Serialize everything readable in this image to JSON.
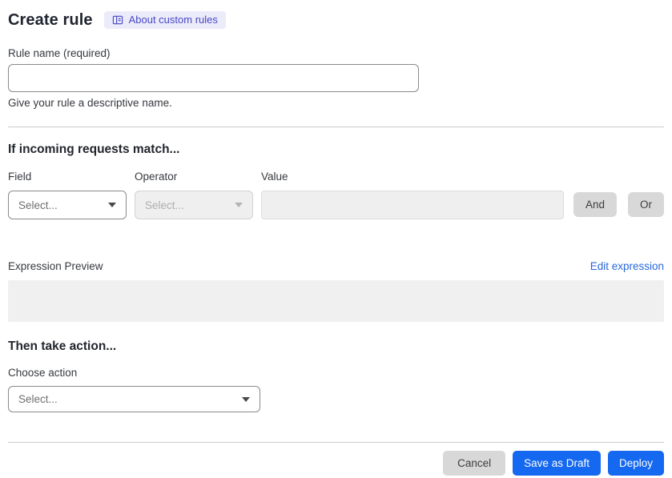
{
  "header": {
    "title": "Create rule",
    "about_badge": "About custom rules"
  },
  "rule_name": {
    "label": "Rule name (required)",
    "value": "",
    "helper": "Give your rule a descriptive name."
  },
  "match_section": {
    "heading": "If incoming requests match...",
    "field": {
      "label": "Field",
      "placeholder": "Select..."
    },
    "operator": {
      "label": "Operator",
      "placeholder": "Select..."
    },
    "value": {
      "label": "Value",
      "value": ""
    },
    "and_label": "And",
    "or_label": "Or"
  },
  "expression": {
    "label": "Expression Preview",
    "edit_link": "Edit expression",
    "content": ""
  },
  "action_section": {
    "heading": "Then take action...",
    "choose_label": "Choose action",
    "placeholder": "Select..."
  },
  "footer": {
    "cancel": "Cancel",
    "save_draft": "Save as Draft",
    "deploy": "Deploy"
  },
  "colors": {
    "accent_blue": "#1568f0",
    "link_blue": "#2768d9",
    "badge_bg": "#ecebfa",
    "badge_text": "#4748c8",
    "disabled_bg": "#efefef",
    "gray_button_bg": "#d8d8d8",
    "divider": "#cbcbcb"
  },
  "icons": {
    "badge_icon": "docs-book-icon",
    "select_caret": "chevron-down-icon"
  }
}
